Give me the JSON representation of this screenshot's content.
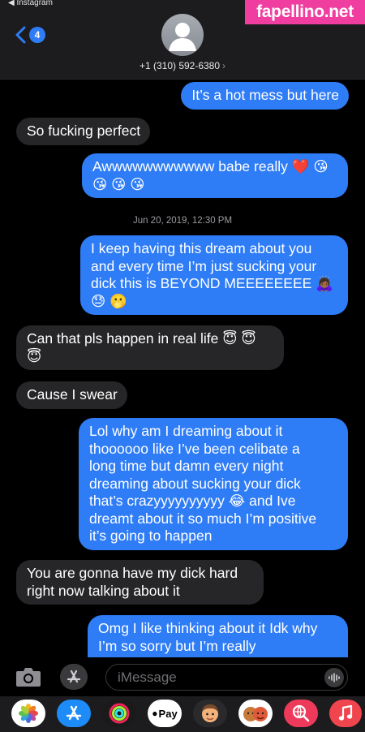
{
  "status_bar": {
    "back_app": "◀ Instagram"
  },
  "header": {
    "badge_count": "4",
    "phone_number": "+1 (310) 592-6380",
    "chevron": "›"
  },
  "watermark": {
    "text": "fapellino.net"
  },
  "messages": [
    {
      "dir": "out",
      "lines": [
        "It’s a hot mess but here"
      ]
    },
    {
      "dir": "in",
      "lines": [
        "So fucking perfect"
      ]
    },
    {
      "dir": "out",
      "lines": [
        "Awwwwwwwwwww babe really ❤️ 😘",
        "😘 😘 😘"
      ]
    },
    {
      "dir": "out",
      "lines": [
        "I keep having this dream about you",
        "and every time I’m just sucking your",
        "dick this is BEYOND MEEEEEEEE 🙇🏾‍♀️",
        "😓 🫢"
      ]
    },
    {
      "dir": "in",
      "lines": [
        "Can that pls happen in real life 😇 😇",
        "😇"
      ]
    },
    {
      "dir": "in",
      "lines": [
        "Cause I swear"
      ]
    },
    {
      "dir": "out",
      "lines": [
        "Lol why am I dreaming about it",
        "thoooooo like I’ve been celibate a",
        "long time but damn every night",
        "dreaming about sucking your dick",
        "that’s crazyyyyyyyyyy 😂 and Ive",
        "dreamt about it so much I’m positive",
        "it’s going to happen"
      ]
    },
    {
      "dir": "in",
      "lines": [
        "You are gonna have my dick hard",
        "right now talking about it"
      ]
    },
    {
      "dir": "out",
      "lines": [
        "Omg I like thinking about it Idk why",
        "I’m so sorry but I’m really"
      ]
    }
  ],
  "timestamp": "Jun 20, 2019, 12:30 PM",
  "composer": {
    "placeholder": "iMessage"
  },
  "tray": {
    "apps": [
      {
        "name": "photos-app-icon",
        "color": "#ffffff"
      },
      {
        "name": "app-store-app-icon",
        "color": "#1d8cf8"
      },
      {
        "name": "activity-app-icon",
        "color": "#1a1a1a"
      },
      {
        "name": "apple-pay-app-icon",
        "color": "#ffffff",
        "label": "Pay"
      },
      {
        "name": "memoji-app-icon",
        "color": "#2a2a2c"
      },
      {
        "name": "animoji-app-icon",
        "color": "#ffffff"
      },
      {
        "name": "image-search-app-icon",
        "color": "#ee3a5a"
      },
      {
        "name": "music-app-icon",
        "color": "#f0454e"
      }
    ]
  }
}
